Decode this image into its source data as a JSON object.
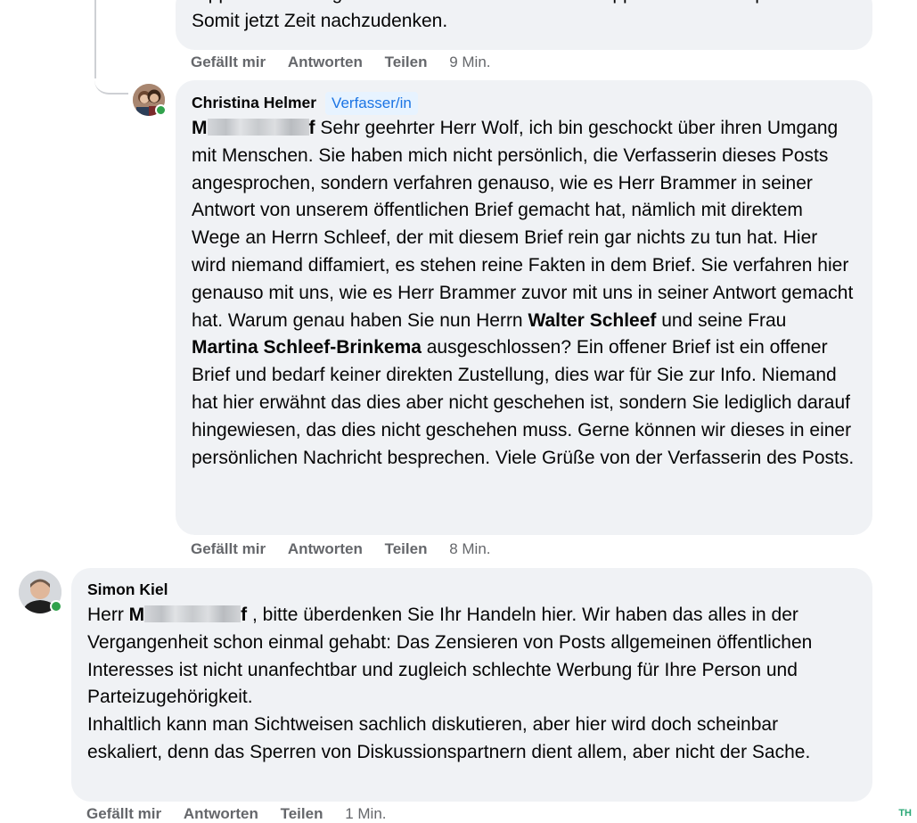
{
  "comments": [
    {
      "lines": [
        "Sippenhaft auch geklärt. Die Art und Weise ihrer Sippe hat mit der Sperre",
        "Somit jetzt Zeit nachzudenken."
      ],
      "actions": {
        "like": "Gefällt mir",
        "reply": "Antworten",
        "share": "Teilen",
        "time": "9 Min."
      }
    },
    {
      "author": "Christina Helmer",
      "badge": "Verfasser/in",
      "mention_start": "M",
      "mention_end": "f",
      "text": {
        "p1": " Sehr geehrter Herr Wolf, ich bin geschockt über ihren Umgang mit Menschen. Sie haben mich nicht persönlich, die Verfasserin dieses Posts angesprochen, sondern verfahren genauso, wie es Herr Brammer in seiner Antwort von unserem öffentlichen Brief gemacht hat, nämlich mit direktem Wege an Herrn Schleef, der mit diesem Brief rein gar nichts zu tun hat. Hier wird niemand diffamiert, es stehen reine Fakten in dem Brief. Sie verfahren hier genauso mit uns, wie es Herr Brammer zuvor mit uns in seiner Antwort gemacht hat. Warum genau haben Sie nun Herrn ",
        "bold1": "Walter Schleef",
        "p2": " und seine Frau ",
        "bold2": "Martina Schleef-Brinkema",
        "p3": " ausgeschlossen? Ein offener Brief ist ein offener Brief und bedarf keiner direkten Zustellung, dies war für Sie zur Info. Niemand hat hier erwähnt das dies aber nicht geschehen ist, sondern Sie lediglich darauf hingewiesen, das dies nicht geschehen muss. Gerne können wir dieses in einer persönlichen Nachricht besprechen. Viele Grüße von der Verfasserin des Posts."
      },
      "actions": {
        "like": "Gefällt mir",
        "reply": "Antworten",
        "share": "Teilen",
        "time": "8 Min."
      }
    },
    {
      "author": "Simon Kiel",
      "text": {
        "pre": "Herr ",
        "mention_start": "M",
        "mention_end": "f",
        "p1": " , bitte überdenken Sie Ihr Handeln hier. Wir haben das alles in der Vergangenheit schon einmal gehabt: Das Zensieren von Posts allgemeinen öffentlichen Interesses ist nicht unanfechtbar und zugleich schlechte Werbung für Ihre Person und Parteizugehörigkeit.",
        "p2": "Inhaltlich kann man Sichtweisen sachlich diskutieren, aber hier wird doch scheinbar eskaliert, denn das Sperren von Diskussionspartnern dient allem, aber nicht der Sache."
      },
      "actions": {
        "like": "Gefällt mir",
        "reply": "Antworten",
        "share": "Teilen",
        "time": "1 Min."
      }
    }
  ],
  "watermark": "TH",
  "colors": {
    "bubble": "#f0f2f5",
    "meta": "#65676b",
    "badge_bg": "#e7f3ff",
    "badge_text": "#1b74e4",
    "online": "#31a24c"
  }
}
